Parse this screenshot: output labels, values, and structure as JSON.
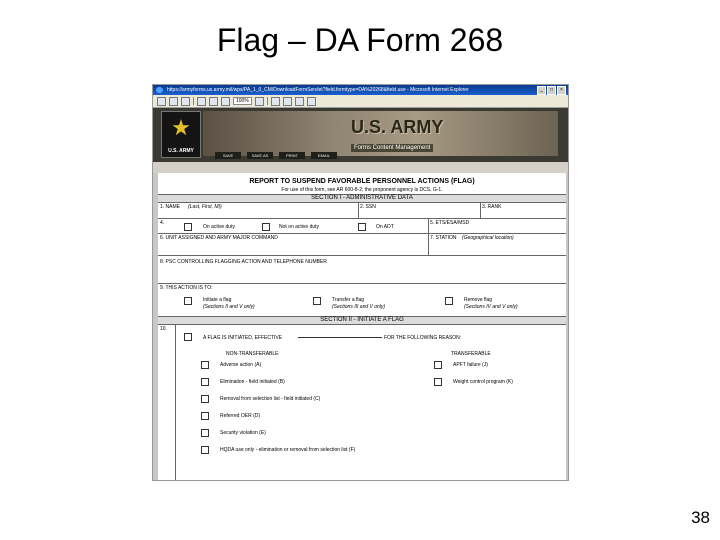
{
  "slide": {
    "title": "Flag – DA Form 268",
    "page_number": "38"
  },
  "browser": {
    "window_title": "https://armyforms.us.army.mil/wps/PA_1_0_CM/DownloadFormServlet?field.formtype=DA%20268&field.use - Microsoft Internet Explorer",
    "minimize": "_",
    "maximize": "□",
    "close": "×",
    "zoom_value": "100%"
  },
  "banner": {
    "logo_text": "U.S. ARMY",
    "brand_title": "U.S. ARMY",
    "brand_subtitle": "Forms Content Management",
    "actions": [
      "SAVE",
      "SAVE AS",
      "PRINT",
      "EMAIL"
    ]
  },
  "form": {
    "title": "REPORT TO SUSPEND FAVORABLE PERSONNEL ACTIONS (FLAG)",
    "subtitle": "For use of this form, see AR 600-8-2; the proponent agency is DCS, G-1.",
    "section1": "SECTION I - ADMINISTRATIVE DATA",
    "fields": {
      "name_label": "1. NAME",
      "name_hint": "(Last, First, MI)",
      "ssn_label": "2. SSN",
      "rank_label": "3. RANK",
      "item4": "4.",
      "active": "On active duty",
      "not_active": "Not on active duty",
      "adt": "On ADT",
      "etsm": "5. ETS/ESA/MSD",
      "unit": "6. UNIT ASSIGNED AND ARMY MAJOR COMMAND",
      "station_label": "7. STATION",
      "station_hint": "(Geographical location)",
      "psc": "8. PSC CONTROLLING FLAGGING ACTION AND TELEPHONE NUMBER",
      "action_to": "9. THIS ACTION IS TO:",
      "initiate": "Initiate a flag",
      "initiate_hint": "(Sections II and V only)",
      "transfer": "Transfer a flag",
      "transfer_hint": "(Sections III and V only)",
      "remove": "Remove flag",
      "remove_hint": "(Sections IV and V only)"
    },
    "section2": "SECTION II - INITIATE A FLAG",
    "item10": "10.",
    "flag_effective": "A FLAG IS INITIATED, EFFECTIVE",
    "following_reason": "FOR THE FOLLOWING REASON:",
    "non_transferable_label": "NON-TRANSFERABLE",
    "transferable_label": "TRANSFERABLE",
    "non_transferable": [
      "Adverse action (A)",
      "Elimination - field initiated (B)",
      "Removal from selection list - field initiated (C)",
      "Referred OER (D)",
      "Security violation (E)",
      "HQDA use only - elimination or removal from selection list (F)"
    ],
    "transferable": [
      "APFT failure (J)",
      "Weight control program (K)"
    ]
  }
}
